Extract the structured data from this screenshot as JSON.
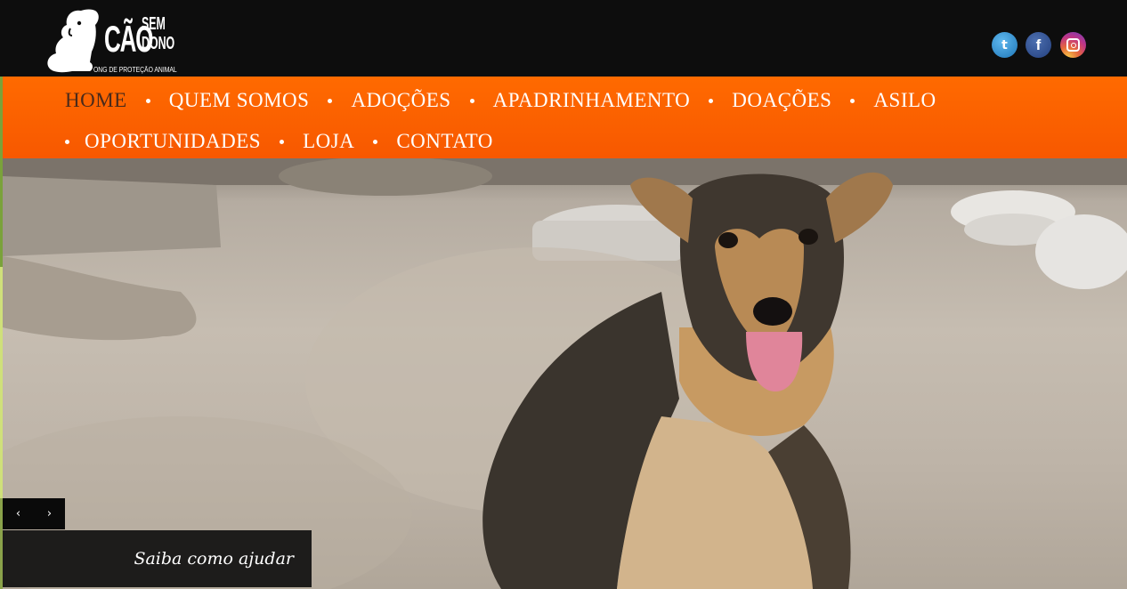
{
  "brand": {
    "line1": "CÃO",
    "line2": "SEM",
    "line3": "DONO",
    "tagline": "ONG DE PROTEÇÃO ANIMAL"
  },
  "social": [
    {
      "name": "twitter",
      "glyph": "t"
    },
    {
      "name": "facebook",
      "glyph": "f"
    },
    {
      "name": "instagram",
      "glyph": ""
    }
  ],
  "nav": {
    "row1": [
      "HOME",
      "QUEM SOMOS",
      "ADOÇÕES",
      "APADRINHAMENTO",
      "DOAÇÕES",
      "ASILO"
    ],
    "row2": [
      "OPORTUNIDADES",
      "LOJA",
      "CONTATO"
    ],
    "active": "HOME"
  },
  "slider": {
    "prev": "‹",
    "next": "›",
    "caption": "Saiba como ajudar"
  },
  "colors": {
    "header_bg": "#0d0d0d",
    "nav_bg": "#ff6a00",
    "active_text": "#4a2a1a"
  }
}
